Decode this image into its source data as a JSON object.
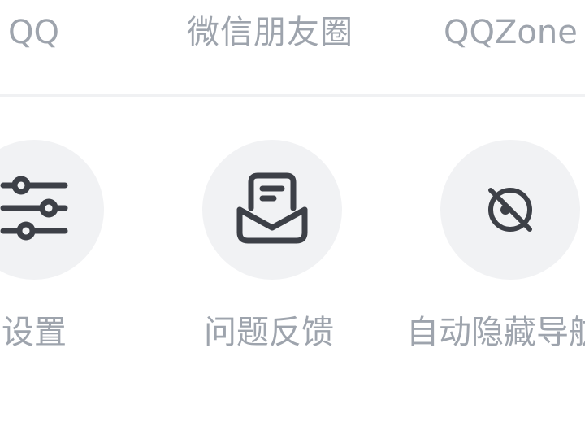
{
  "share_targets": [
    {
      "label": "QQ"
    },
    {
      "label": "微信朋友圈"
    },
    {
      "label": "QQZone"
    }
  ],
  "actions": [
    {
      "label": "设置",
      "icon": "settings-sliders-icon"
    },
    {
      "label": "问题反馈",
      "icon": "feedback-mail-icon"
    },
    {
      "label": "自动隐藏导航",
      "icon": "hide-eye-slash-icon"
    }
  ],
  "colors": {
    "label": "#9ea4ad",
    "icon": "#3d4047",
    "circle_bg": "#f1f2f4",
    "divider": "#f0f1f3"
  }
}
